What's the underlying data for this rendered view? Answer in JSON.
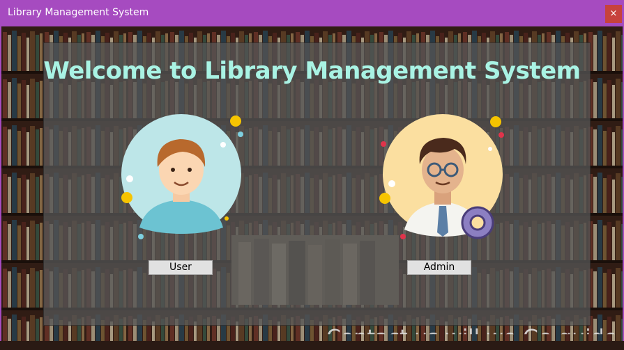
{
  "window": {
    "title": "Library Management System",
    "close_icon": "close-icon",
    "close_glyph": "×",
    "accent_color": "#a64bc0"
  },
  "main": {
    "heading": "Welcome to Library Management System",
    "heading_color": "#a9f3e4",
    "user_button_label": "User",
    "admin_button_label": "Admin",
    "user_avatar": "user-avatar-icon",
    "admin_avatar": "admin-avatar-icon",
    "footer_partial_text": "Contact us will we Go guide"
  }
}
